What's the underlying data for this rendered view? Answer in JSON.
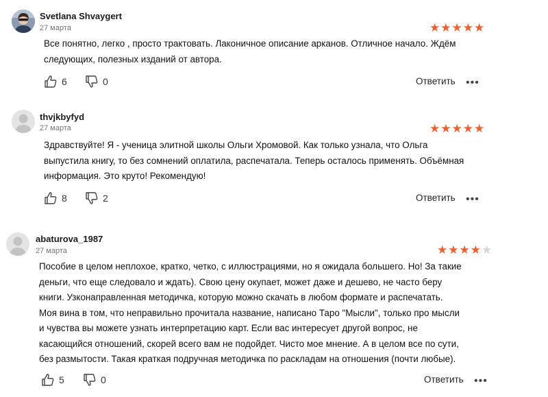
{
  "colors": {
    "star_filled": "#f0602c",
    "star_empty": "#d6d6d6"
  },
  "reviews": [
    {
      "author": "Svetlana Shvaygert",
      "date": "27 марта",
      "rating": 5,
      "lines": [
        "Все понятно, легко , просто трактовать. Лаконичное описание арканов. Отличное начало. Ждём",
        "следующих, полезных изданий от автора."
      ],
      "likes": "6",
      "dislikes": "0",
      "reply_label": "Ответить",
      "more_label": "•••",
      "avatar": "photo"
    },
    {
      "author": "thvjkbyfyd",
      "date": "27 марта",
      "rating": 5,
      "lines": [
        "Здравствуйте! Я - ученица элитной школы Ольги Хромовой. Как только узнала, что Ольга",
        "выпустила книгу, то без сомнений оплатила, распечатала. Теперь осталось применять. Объёмная",
        "информация. Это круто! Рекомендую!"
      ],
      "likes": "8",
      "dislikes": "2",
      "reply_label": "Ответить",
      "more_label": "•••",
      "avatar": "placeholder"
    },
    {
      "author": "abaturova_1987",
      "date": "27 марта",
      "rating": 4,
      "lines": [
        "Пособие в целом неплохое, кратко, четко, с иллюстрациями, но я ожидала большего. Но! За такие",
        "деньги, что еще следовало и ждать). Свою цену окупает, может даже и дешево, не часто беру",
        "книги. Узконаправленная методичка, которую можно скачать в любом формате и распечатать.",
        "Моя вина в том, что неправильно прочитала название, написано Таро \"Мысли\", только про мысли",
        "и чувства вы можете узнать интерпретацию карт. Если вас интересует другой вопрос, не",
        "касающийся отношений, скорей всего вам не подойдет. Чисто мое мнение. А в целом все по сути,",
        "без размытости. Такая краткая подручная методичка по раскладам на отношения (почти любые)."
      ],
      "likes": "5",
      "dislikes": "0",
      "reply_label": "Ответить",
      "more_label": "•••",
      "avatar": "placeholder"
    }
  ]
}
